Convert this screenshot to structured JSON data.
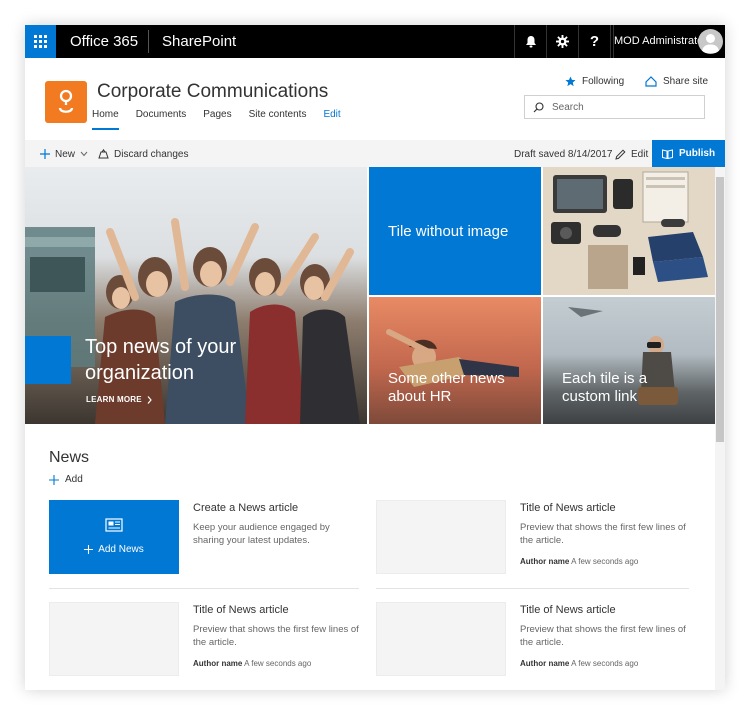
{
  "suite": {
    "app_name": "Office 365",
    "product": "SharePoint",
    "help_label": "?",
    "user_name": "MOD Administrator"
  },
  "site": {
    "title": "Corporate Communications",
    "logo_color": "#f27a21",
    "nav": [
      {
        "label": "Home",
        "selected": true
      },
      {
        "label": "Documents"
      },
      {
        "label": "Pages"
      },
      {
        "label": "Site contents"
      },
      {
        "label": "Edit",
        "link": true
      }
    ],
    "following_label": "Following",
    "share_label": "Share site",
    "search_placeholder": "Search"
  },
  "commands": {
    "new_label": "New",
    "discard_label": "Discard changes",
    "draft_status": "Draft saved 8/14/2017",
    "edit_label": "Edit",
    "publish_label": "Publish"
  },
  "hero": {
    "main_title": "Top news of your organization",
    "learn_more": "LEARN MORE",
    "tile_no_image": "Tile without image",
    "tile_hr": "Some other news about HR",
    "tile_custom": "Each tile is a custom link"
  },
  "news": {
    "section_title": "News",
    "add_label": "Add",
    "create": {
      "heading": "Create a News article",
      "description": "Keep your audience engaged by sharing your latest updates.",
      "button": "Add News"
    },
    "articles": [
      {
        "title": "Title of News article",
        "preview": "Preview that shows the first few lines of the article.",
        "author": "Author name",
        "time": "A few seconds ago"
      },
      {
        "title": "Title of News article",
        "preview": "Preview that shows the first few lines of the article.",
        "author": "Author name",
        "time": "A few seconds ago"
      },
      {
        "title": "Title of News article",
        "preview": "Preview that shows the first few lines of the article.",
        "author": "Author name",
        "time": "A few seconds ago"
      }
    ]
  },
  "colors": {
    "accent": "#0078d4",
    "suitebar": "#000000"
  }
}
